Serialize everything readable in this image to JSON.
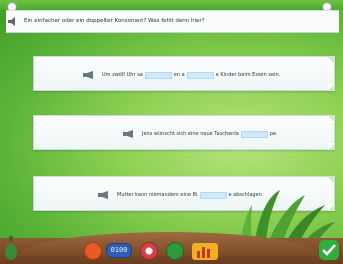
{
  "instruction": {
    "text": "Ein einfacher oder ein doppelter Konsonant? Was fehlt denn hier?"
  },
  "exercises": [
    {
      "before": "Um zwölf Uhr sa",
      "middle": "en a",
      "after": "e Kinder beim Essen sein."
    },
    {
      "before": "Jens wünscht sich eine neue Taschenla",
      "middle": "",
      "after": "pe."
    },
    {
      "before": "Mutter kann niemandem eine Bi",
      "middle": "",
      "after": "e abschlagen."
    }
  ],
  "toolbar": {
    "items": [
      {
        "icon": "traffic-cone-icon",
        "color": "#e85a24"
      },
      {
        "icon": "number-display-icon",
        "label": "0100",
        "color": "#2f5fb5"
      },
      {
        "icon": "lifebuoy-icon",
        "color": "#d64040"
      },
      {
        "icon": "book-icon",
        "color": "#2f9a3a"
      },
      {
        "icon": "bar-chart-icon",
        "color": "#f0b020"
      }
    ],
    "confirm_icon": "checkmark-icon",
    "confirm_color": "#2fae3a",
    "left_icon": "bottle-icon"
  }
}
